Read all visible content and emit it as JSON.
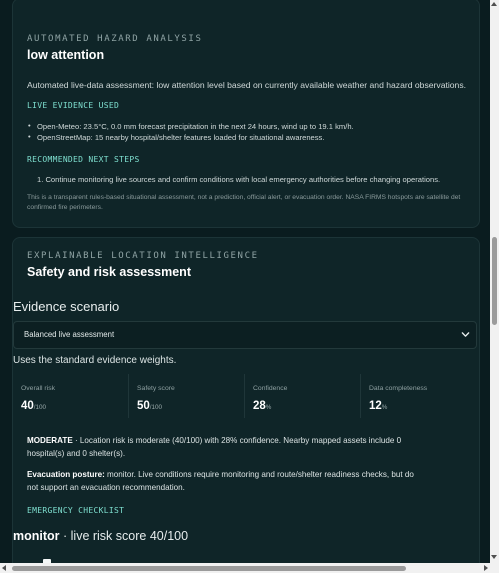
{
  "hazard_card": {
    "eyebrow": "AUTOMATED HAZARD ANALYSIS",
    "title": "low attention",
    "summary": "Automated live-data assessment: low attention level based on currently available weather and hazard observations.",
    "evidence_heading": "LIVE EVIDENCE USED",
    "evidence": [
      "Open-Meteo: 23.5°C, 0.0 mm forecast precipitation in the next 24 hours, wind up to 19.1 km/h.",
      "OpenStreetMap: 15 nearby hospital/shelter features loaded for situational awareness."
    ],
    "steps_heading": "RECOMMENDED NEXT STEPS",
    "steps": [
      "1. Continue monitoring live sources and confirm conditions with local emergency authorities before changing operations."
    ],
    "disclaimer_line1": "This is a transparent rules-based situational assessment, not a prediction, official alert, or evacuation order. NASA FIRMS hotspots are satellite det",
    "disclaimer_line2": "confirmed fire perimeters."
  },
  "intel_card": {
    "eyebrow": "EXPLAINABLE LOCATION INTELLIGENCE",
    "title": "Safety and risk assessment",
    "scenario_label": "Evidence scenario",
    "scenario_value": "Balanced live assessment",
    "scenario_help": "Uses the standard evidence weights.",
    "metrics": [
      {
        "label": "Overall risk",
        "value": "40",
        "unit": "/100"
      },
      {
        "label": "Safety score",
        "value": "50",
        "unit": "/100"
      },
      {
        "label": "Confidence",
        "value": "28",
        "unit": "%"
      },
      {
        "label": "Data completeness",
        "value": "12",
        "unit": "%"
      }
    ],
    "moderate_label": "MODERATE",
    "moderate_line1": " · Location risk is moderate (40/100) with 28% confidence. Nearby mapped assets include 0",
    "moderate_line2": "hospital(s) and 0 shelter(s).",
    "evac_label": "Evacuation posture:",
    "evac_line1": " monitor. Live conditions require monitoring and route/shelter readiness checks, but do",
    "evac_line2": "not support an evacuation recommendation.",
    "checklist_heading": "EMERGENCY CHECKLIST",
    "monitor_label": "monitor",
    "monitor_text": " · live risk score 40/100"
  },
  "colors": {
    "background": "#0a1c1f",
    "card": "#0f2528",
    "accent": "#7fe0d0"
  },
  "icons": {
    "dropdown": "chevron-down-icon",
    "bullet": "disc"
  }
}
